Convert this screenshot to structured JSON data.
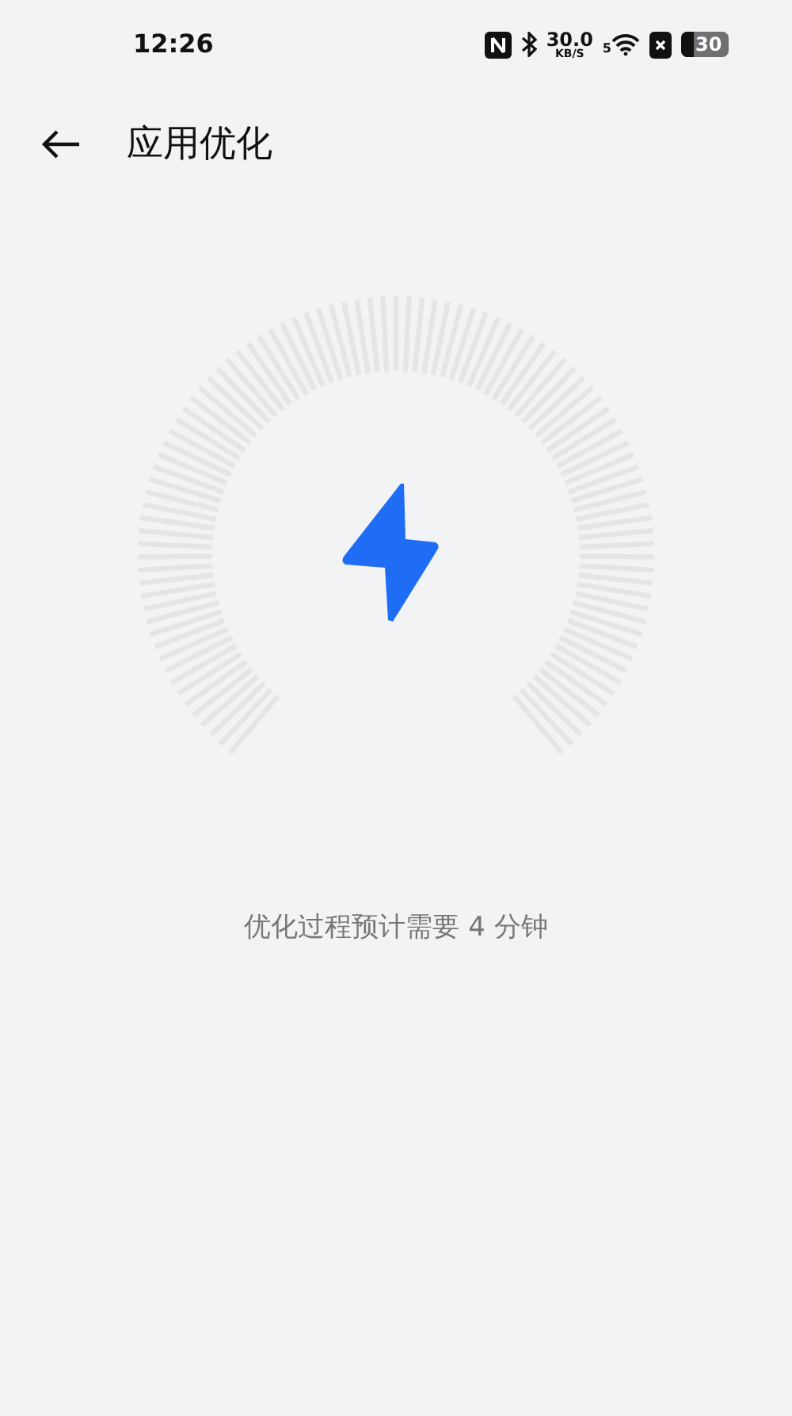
{
  "status_bar": {
    "time": "12:26",
    "net_speed": "30.0",
    "net_unit": "KB/S",
    "wifi_badge": "5",
    "battery": "30"
  },
  "header": {
    "title": "应用优化"
  },
  "message": "优化过程预计需要 4 分钟"
}
